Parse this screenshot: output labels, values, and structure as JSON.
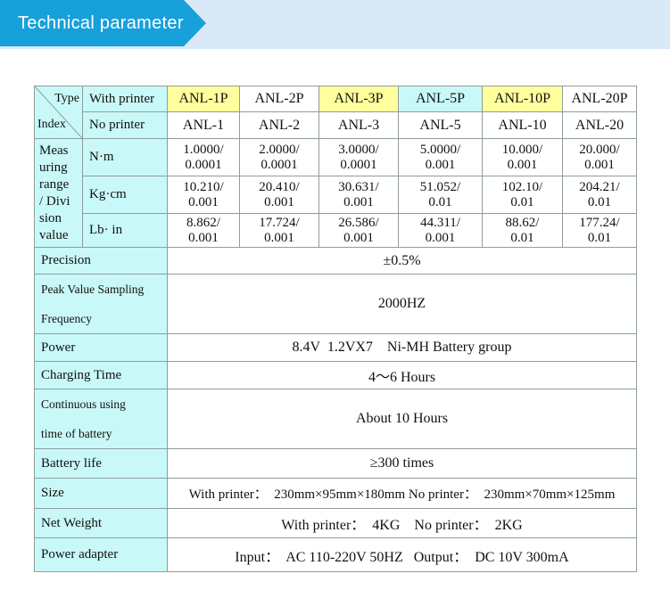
{
  "header": {
    "title": "Technical parameter"
  },
  "colors": {
    "banner_blue": "#18a0da",
    "strip_blue": "#d9e9f7",
    "highlight_yellow": "#ffff9e",
    "highlight_cyan": "#c9f8f8",
    "border_gray": "#8f9d9d"
  },
  "table": {
    "corner": {
      "top_right": "Type",
      "bottom_left": "Index"
    },
    "with_printer": {
      "label": "With printer",
      "models": [
        "ANL-1P",
        "ANL-2P",
        "ANL-3P",
        "ANL-5P",
        "ANL-10P",
        "ANL-20P"
      ]
    },
    "no_printer": {
      "label": "No printer",
      "models": [
        "ANL-1",
        "ANL-2",
        "ANL-3",
        "ANL-5",
        "ANL-10",
        "ANL-20"
      ]
    },
    "measuring": {
      "label": "Meas\nuring\nrange\n/ Divi\nsion\nvalue",
      "rows": [
        {
          "unit": "N·m",
          "values": [
            "1.0000/\n0.0001",
            "2.0000/\n0.0001",
            "3.0000/\n0.0001",
            "5.0000/\n0.001",
            "10.000/\n0.001",
            "20.000/\n0.001"
          ]
        },
        {
          "unit": "Kg·cm",
          "values": [
            "10.210/\n0.001",
            "20.410/\n0.001",
            "30.631/\n0.001",
            "51.052/\n0.01",
            "102.10/\n0.01",
            "204.21/\n0.01"
          ]
        },
        {
          "unit": "Lb· in",
          "values": [
            "8.862/\n0.001",
            "17.724/\n0.001",
            "26.586/\n0.001",
            "44.311/\n0.001",
            "88.62/\n0.01",
            "177.24/\n0.01"
          ]
        }
      ]
    },
    "specs": [
      {
        "label": "Precision",
        "value": "±0.5%"
      },
      {
        "label": "Peak Value Sampling\nFrequency",
        "value": "2000HZ"
      },
      {
        "label": "Power",
        "value": "8.4V  1.2VX7    Ni-MH Battery group"
      },
      {
        "label": "Charging Time",
        "value": "4～6 Hours"
      },
      {
        "label": "Continuous using\ntime of battery",
        "value": "About 10 Hours"
      },
      {
        "label": "Battery life",
        "value": "≥300 times"
      },
      {
        "label": "Size",
        "value": "With printer：  230mm×95mm×180mm No printer：  230mm×70mm×125mm"
      },
      {
        "label": "Net Weight",
        "value": "With printer：  4KG    No printer：  2KG"
      },
      {
        "label": "Power adapter",
        "value": "Input：  AC 110-220V 50HZ   Output：  DC 10V 300mA"
      }
    ]
  }
}
